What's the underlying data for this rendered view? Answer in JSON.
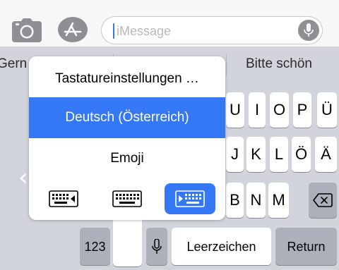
{
  "message_bar": {
    "placeholder": "iMessage"
  },
  "predictions": {
    "left": "Gern",
    "right": "Bitte schön"
  },
  "keyboard_menu": {
    "items": [
      {
        "label": "Tastatureinstellungen …",
        "selected": false
      },
      {
        "label": "Deutsch (Österreich)",
        "selected": true
      },
      {
        "label": "Emoji",
        "selected": false
      }
    ],
    "modes": [
      "left-handed",
      "default",
      "right-handed"
    ],
    "active_mode": "right-handed"
  },
  "keys": {
    "row1": [
      "U",
      "I",
      "O",
      "P",
      "Ü"
    ],
    "row2": [
      "J",
      "K",
      "L",
      "Ö",
      "Ä"
    ],
    "row3": [
      "B",
      "N",
      "M"
    ],
    "numbers": "123",
    "space": "Leerzeichen",
    "return": "Return"
  },
  "colors": {
    "accent": "#3478f6",
    "keyboard_bg": "#d1d4da",
    "dark_key": "#abb0ba"
  },
  "icons": [
    "camera-icon",
    "app-store-icon",
    "microphone-icon",
    "backspace-icon",
    "chevron-left-icon",
    "keyboard-icon"
  ]
}
